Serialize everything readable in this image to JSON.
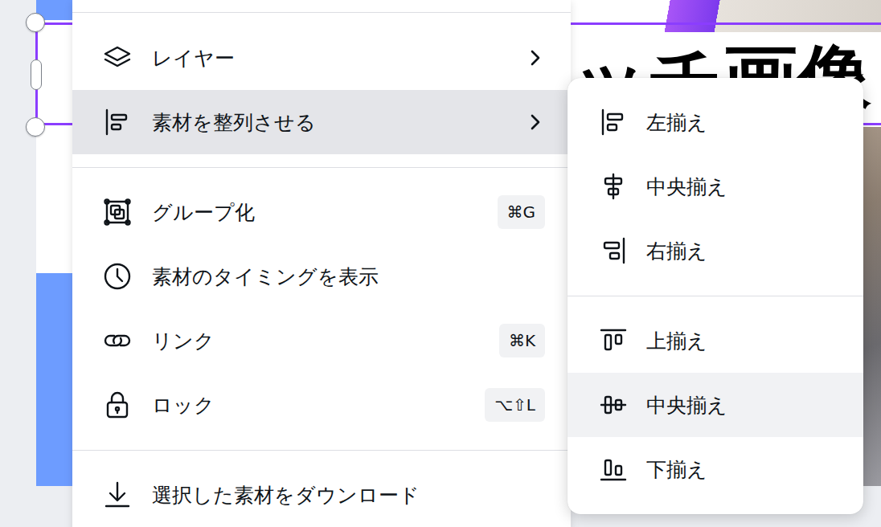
{
  "canvas": {
    "heading": "ッチ画像"
  },
  "menu": {
    "groups": [
      [
        {
          "label": "レイヤー",
          "has_submenu": true,
          "selected": false
        },
        {
          "label": "素材を整列させる",
          "has_submenu": true,
          "selected": true
        }
      ],
      [
        {
          "label": "グループ化",
          "shortcut": "⌘G",
          "has_submenu": false,
          "selected": false
        },
        {
          "label": "素材のタイミングを表示",
          "has_submenu": false,
          "selected": false
        },
        {
          "label": "リンク",
          "shortcut": "⌘K",
          "has_submenu": false,
          "selected": false
        },
        {
          "label": "ロック",
          "shortcut": "⌥⇧L",
          "has_submenu": false,
          "selected": false
        }
      ],
      [
        {
          "label": "選択した素材をダウンロード",
          "has_submenu": false,
          "selected": false
        }
      ]
    ]
  },
  "submenu": {
    "groups": [
      [
        {
          "label": "左揃え",
          "selected": false
        },
        {
          "label": "中央揃え",
          "selected": false
        },
        {
          "label": "右揃え",
          "selected": false
        }
      ],
      [
        {
          "label": "上揃え",
          "selected": false
        },
        {
          "label": "中央揃え",
          "selected": true
        },
        {
          "label": "下揃え",
          "selected": false
        }
      ]
    ]
  }
}
